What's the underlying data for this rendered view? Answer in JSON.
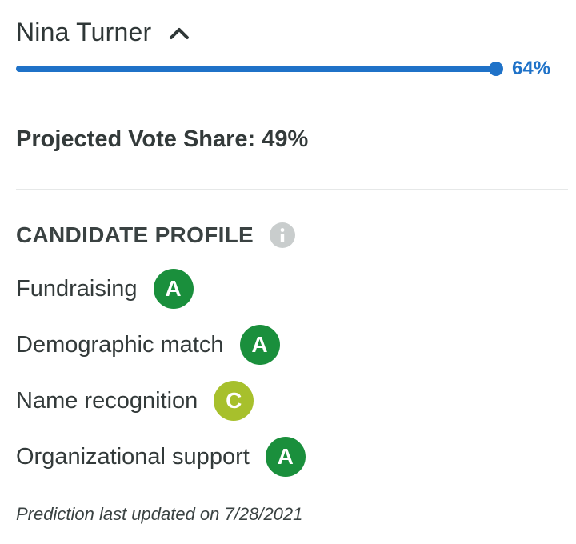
{
  "candidate": {
    "name": "Nina Turner",
    "chevron_icon": "chevron-up-icon"
  },
  "progress": {
    "percent_value": 64,
    "percent_label": "64%",
    "color": "#1f72c8",
    "track_color": "#d9e4f0"
  },
  "projected_vote_share": "Projected Vote Share: 49%",
  "profile": {
    "title": "CANDIDATE PROFILE",
    "info_icon": "info-icon",
    "items": [
      {
        "label": "Fundraising",
        "grade": "A",
        "color": "#1a8f3c"
      },
      {
        "label": "Demographic match",
        "grade": "A",
        "color": "#1a8f3c"
      },
      {
        "label": "Name recognition",
        "grade": "C",
        "color": "#a7c02c"
      },
      {
        "label": "Organizational support",
        "grade": "A",
        "color": "#1a8f3c"
      }
    ]
  },
  "footer": {
    "note": "Prediction last updated on 7/28/2021"
  }
}
